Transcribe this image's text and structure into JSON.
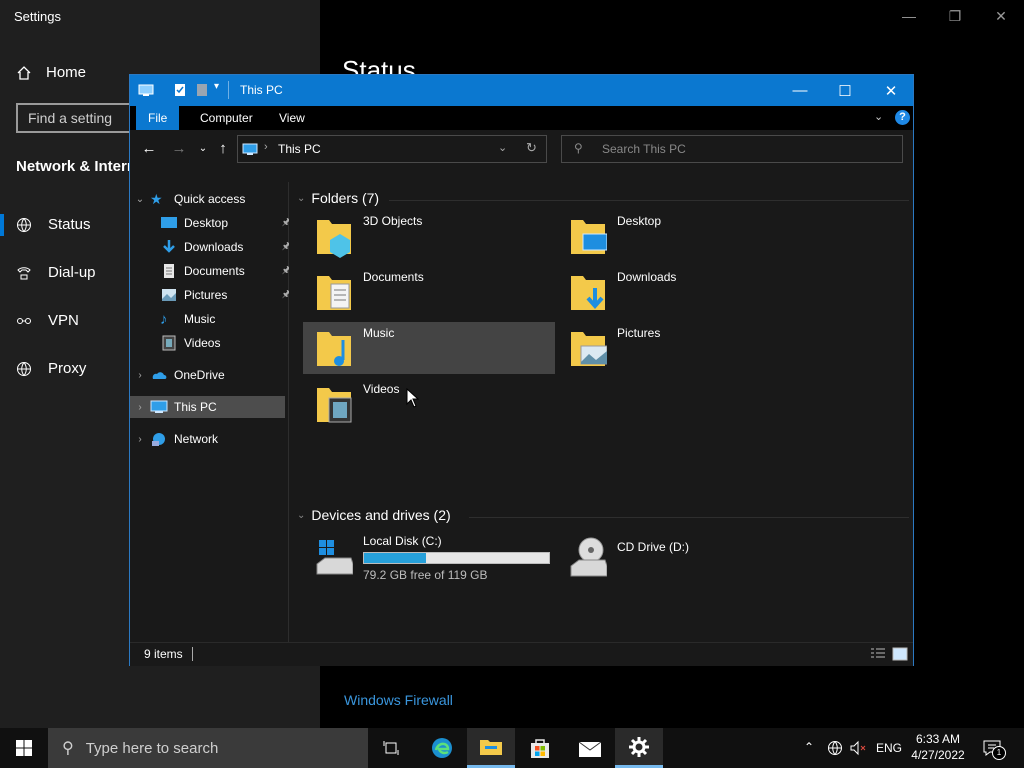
{
  "settings": {
    "title": "Settings",
    "home_label": "Home",
    "find_placeholder": "Find a setting",
    "section_title": "Network & Internet",
    "nav": [
      {
        "label": "Status",
        "icon": "globe-icon"
      },
      {
        "label": "Dial-up",
        "icon": "dialup-icon"
      },
      {
        "label": "VPN",
        "icon": "vpn-icon"
      },
      {
        "label": "Proxy",
        "icon": "globe-icon"
      }
    ],
    "page_heading": "Status",
    "firewall_link": "Windows Firewall"
  },
  "explorer": {
    "title": "This PC",
    "ribbon_tabs": [
      "File",
      "Computer",
      "View"
    ],
    "address": "This PC",
    "search_placeholder": "Search This PC",
    "tree": {
      "quick_access": "Quick access",
      "items": [
        {
          "label": "Desktop",
          "pinned": true
        },
        {
          "label": "Downloads",
          "pinned": true
        },
        {
          "label": "Documents",
          "pinned": true
        },
        {
          "label": "Pictures",
          "pinned": true
        },
        {
          "label": "Music",
          "pinned": false
        },
        {
          "label": "Videos",
          "pinned": false
        }
      ],
      "onedrive": "OneDrive",
      "this_pc": "This PC",
      "network": "Network"
    },
    "folders_heading": "Folders (7)",
    "folders": [
      "3D Objects",
      "Desktop",
      "Documents",
      "Downloads",
      "Music",
      "Pictures",
      "Videos"
    ],
    "drives_heading": "Devices and drives (2)",
    "drives": [
      {
        "name": "Local Disk (C:)",
        "free_text": "79.2 GB free of 119 GB",
        "used_fraction": 0.335
      },
      {
        "name": "CD Drive (D:)"
      }
    ],
    "status_items": "9 items"
  },
  "taskbar": {
    "search_placeholder": "Type here to search",
    "language": "ENG",
    "time": "6:33 AM",
    "date": "4/27/2022",
    "notification_count": "1"
  }
}
